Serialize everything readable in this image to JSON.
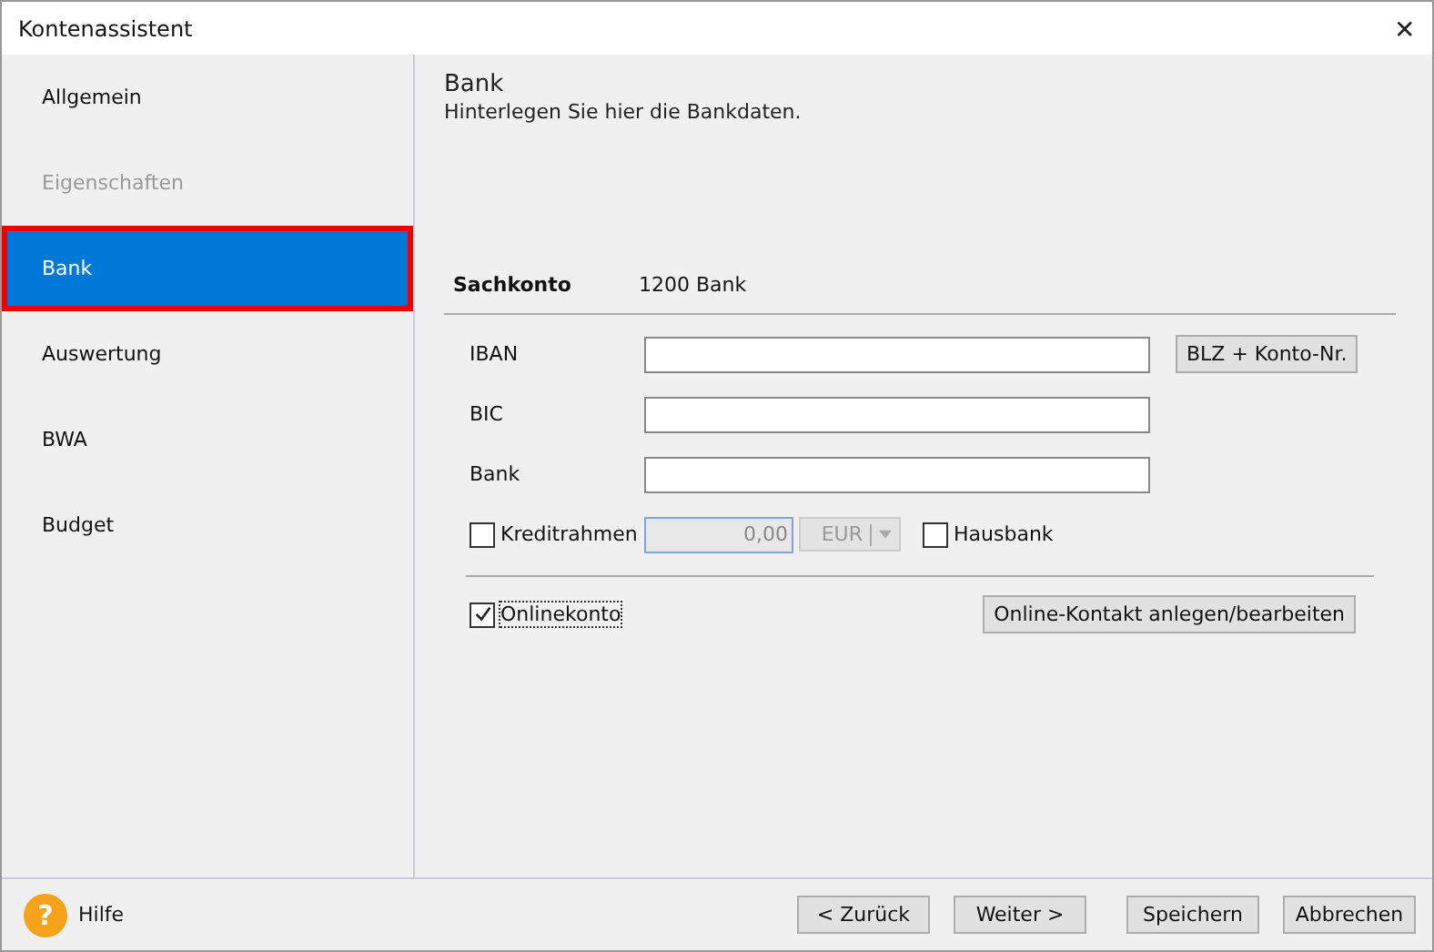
{
  "window": {
    "title": "Kontenassistent",
    "close": "✕"
  },
  "sidebar": {
    "items": [
      {
        "label": "Allgemein",
        "selected": false,
        "disabled": false
      },
      {
        "label": "Eigenschaften",
        "selected": false,
        "disabled": true
      },
      {
        "label": "Bank",
        "selected": true,
        "disabled": false
      },
      {
        "label": "Auswertung",
        "selected": false,
        "disabled": false
      },
      {
        "label": "BWA",
        "selected": false,
        "disabled": false
      },
      {
        "label": "Budget",
        "selected": false,
        "disabled": false
      }
    ]
  },
  "header": {
    "title": "Bank",
    "subtitle": "Hinterlegen Sie hier die Bankdaten."
  },
  "account": {
    "label": "Sachkonto",
    "value": "1200 Bank"
  },
  "fields": [
    {
      "label": "IBAN",
      "button": "BLZ + Konto-Nr."
    },
    {
      "label": "BIC"
    },
    {
      "label": "Bank"
    }
  ],
  "credit": {
    "label": "Kreditrahmen",
    "checked": false,
    "value": "0,00",
    "currency": "EUR",
    "disabled": true
  },
  "house_bank": {
    "label": "Hausbank",
    "checked": false
  },
  "online": {
    "label": "Onlinekonto",
    "checked": true,
    "button": "Online-Kontakt anlegen/bearbeiten"
  },
  "footer": {
    "help_icon": "?",
    "help": "Hilfe",
    "buttons": [
      "< Zurück",
      "Weiter >",
      "Speichern",
      "Abbrechen"
    ]
  }
}
